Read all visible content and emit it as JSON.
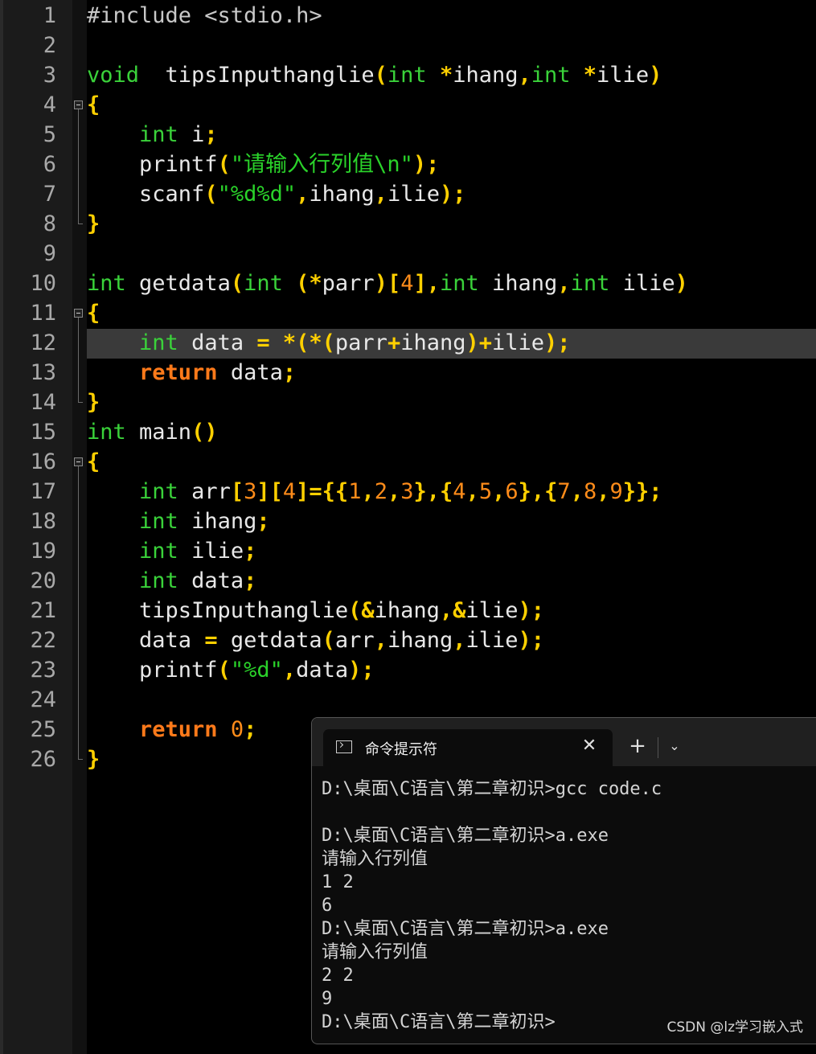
{
  "editor": {
    "line_numbers": [
      "1",
      "2",
      "3",
      "4",
      "5",
      "6",
      "7",
      "8",
      "9",
      "10",
      "11",
      "12",
      "13",
      "14",
      "15",
      "16",
      "17",
      "18",
      "19",
      "20",
      "21",
      "22",
      "23",
      "24",
      "25",
      "26"
    ],
    "code_lines": [
      [
        [
          "pp",
          "#include <stdio.h>"
        ]
      ],
      [],
      [
        [
          "kw",
          "void"
        ],
        [
          "",
          "  tipsInputhanglie"
        ],
        [
          "op",
          "("
        ],
        [
          "kw",
          "int"
        ],
        [
          "op",
          " *"
        ],
        [
          "",
          "ihang"
        ],
        [
          "op",
          ","
        ],
        [
          "kw",
          "int"
        ],
        [
          "op",
          " *"
        ],
        [
          "",
          "ilie"
        ],
        [
          "op",
          ")"
        ]
      ],
      [
        [
          "op",
          "{"
        ]
      ],
      [
        [
          "",
          "    "
        ],
        [
          "kw",
          "int"
        ],
        [
          "",
          " i"
        ],
        [
          "op",
          ";"
        ]
      ],
      [
        [
          "",
          "    printf"
        ],
        [
          "op",
          "("
        ],
        [
          "str",
          "\"请输入行列值\\n\""
        ],
        [
          "op",
          ");"
        ]
      ],
      [
        [
          "",
          "    scanf"
        ],
        [
          "op",
          "("
        ],
        [
          "str",
          "\"%d%d\""
        ],
        [
          "op",
          ","
        ],
        [
          "",
          "ihang"
        ],
        [
          "op",
          ","
        ],
        [
          "",
          "ilie"
        ],
        [
          "op",
          ");"
        ]
      ],
      [
        [
          "op",
          "}"
        ]
      ],
      [],
      [
        [
          "kw",
          "int"
        ],
        [
          "",
          " getdata"
        ],
        [
          "op",
          "("
        ],
        [
          "kw",
          "int"
        ],
        [
          "op",
          " (*"
        ],
        [
          "",
          "parr"
        ],
        [
          "op",
          ")["
        ],
        [
          "num",
          "4"
        ],
        [
          "op",
          "],"
        ],
        [
          "kw",
          "int"
        ],
        [
          "",
          " ihang"
        ],
        [
          "op",
          ","
        ],
        [
          "kw",
          "int"
        ],
        [
          "",
          " ilie"
        ],
        [
          "op",
          ")"
        ]
      ],
      [
        [
          "op",
          "{"
        ]
      ],
      [
        [
          "",
          "    "
        ],
        [
          "kw",
          "int"
        ],
        [
          "",
          " data "
        ],
        [
          "op",
          "="
        ],
        [
          "op",
          " *(*("
        ],
        [
          "",
          "parr"
        ],
        [
          "op",
          "+"
        ],
        [
          "",
          "ihang"
        ],
        [
          "op",
          ")+"
        ],
        [
          "",
          "ilie"
        ],
        [
          "op",
          ");"
        ]
      ],
      [
        [
          "",
          "    "
        ],
        [
          "ret",
          "return"
        ],
        [
          "",
          " data"
        ],
        [
          "op",
          ";"
        ]
      ],
      [
        [
          "op",
          "}"
        ]
      ],
      [
        [
          "kw",
          "int"
        ],
        [
          "",
          " main"
        ],
        [
          "op",
          "()"
        ]
      ],
      [
        [
          "op",
          "{"
        ]
      ],
      [
        [
          "",
          "    "
        ],
        [
          "kw",
          "int"
        ],
        [
          "",
          " arr"
        ],
        [
          "op",
          "["
        ],
        [
          "num",
          "3"
        ],
        [
          "op",
          "]["
        ],
        [
          "num",
          "4"
        ],
        [
          "op",
          "]={{"
        ],
        [
          "num",
          "1"
        ],
        [
          "op",
          ","
        ],
        [
          "num",
          "2"
        ],
        [
          "op",
          ","
        ],
        [
          "num",
          "3"
        ],
        [
          "op",
          "},{"
        ],
        [
          "num",
          "4"
        ],
        [
          "op",
          ","
        ],
        [
          "num",
          "5"
        ],
        [
          "op",
          ","
        ],
        [
          "num",
          "6"
        ],
        [
          "op",
          "},{"
        ],
        [
          "num",
          "7"
        ],
        [
          "op",
          ","
        ],
        [
          "num",
          "8"
        ],
        [
          "op",
          ","
        ],
        [
          "num",
          "9"
        ],
        [
          "op",
          "}};"
        ]
      ],
      [
        [
          "",
          "    "
        ],
        [
          "kw",
          "int"
        ],
        [
          "",
          " ihang"
        ],
        [
          "op",
          ";"
        ]
      ],
      [
        [
          "",
          "    "
        ],
        [
          "kw",
          "int"
        ],
        [
          "",
          " ilie"
        ],
        [
          "op",
          ";"
        ]
      ],
      [
        [
          "",
          "    "
        ],
        [
          "kw",
          "int"
        ],
        [
          "",
          " data"
        ],
        [
          "op",
          ";"
        ]
      ],
      [
        [
          "",
          "    tipsInputhanglie"
        ],
        [
          "op",
          "(&"
        ],
        [
          "",
          "ihang"
        ],
        [
          "op",
          ",&"
        ],
        [
          "",
          "ilie"
        ],
        [
          "op",
          ");"
        ]
      ],
      [
        [
          "",
          "    data "
        ],
        [
          "op",
          "="
        ],
        [
          "",
          " getdata"
        ],
        [
          "op",
          "("
        ],
        [
          "",
          "arr"
        ],
        [
          "op",
          ","
        ],
        [
          "",
          "ihang"
        ],
        [
          "op",
          ","
        ],
        [
          "",
          "ilie"
        ],
        [
          "op",
          ");"
        ]
      ],
      [
        [
          "",
          "    printf"
        ],
        [
          "op",
          "("
        ],
        [
          "str",
          "\"%d\""
        ],
        [
          "op",
          ","
        ],
        [
          "",
          "data"
        ],
        [
          "op",
          ");"
        ]
      ],
      [],
      [
        [
          "",
          "    "
        ],
        [
          "ret",
          "return"
        ],
        [
          "",
          " "
        ],
        [
          "num",
          "0"
        ],
        [
          "op",
          ";"
        ]
      ],
      [
        [
          "op",
          "}"
        ]
      ]
    ]
  },
  "terminal": {
    "tab_title": "命令提示符",
    "close_glyph": "✕",
    "new_tab_glyph": "+",
    "dropdown_glyph": "⌄",
    "lines": [
      "D:\\桌面\\C语言\\第二章初识>gcc code.c",
      "",
      "D:\\桌面\\C语言\\第二章初识>a.exe",
      "请输入行列值",
      "1 2",
      "6",
      "D:\\桌面\\C语言\\第二章初识>a.exe",
      "请输入行列值",
      "2 2",
      "9",
      "D:\\桌面\\C语言\\第二章初识>"
    ]
  },
  "watermark": "CSDN @lz学习嵌入式",
  "colors": {
    "keyword": "#3ad23a",
    "return_keyword": "#ff7a1a",
    "operator": "#ffd000",
    "number": "#ff8c1a",
    "string": "#2ad22a",
    "background": "#000000"
  }
}
